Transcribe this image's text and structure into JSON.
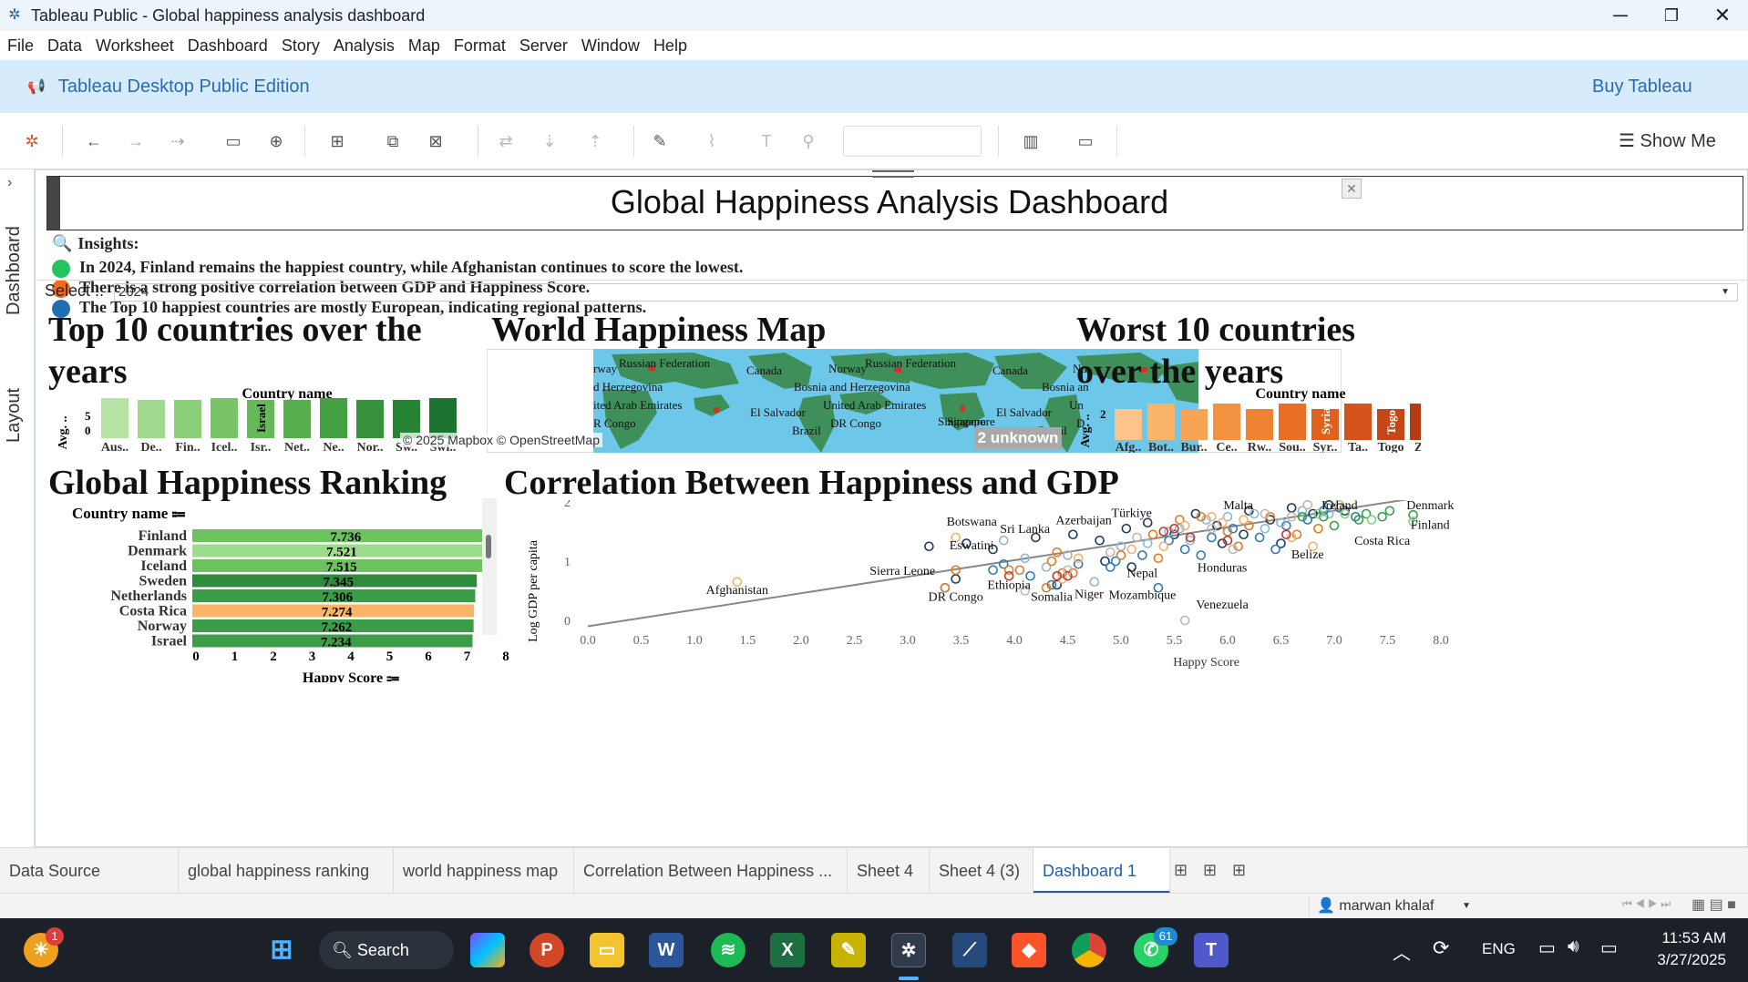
{
  "window": {
    "title": "Tableau Public - Global happiness analysis dashboard"
  },
  "menu": [
    "File",
    "Data",
    "Worksheet",
    "Dashboard",
    "Story",
    "Analysis",
    "Map",
    "Format",
    "Server",
    "Window",
    "Help"
  ],
  "promo": {
    "edition": "Tableau Desktop Public Edition",
    "buy": "Buy Tableau"
  },
  "toolbar": {
    "show_me": "Show Me"
  },
  "rail": {
    "dashboard": "Dashboard",
    "layout": "Layout"
  },
  "dashboard": {
    "title": "Global Happiness Analysis Dashboard",
    "insights_heading": "Insights:",
    "insights": [
      {
        "text": "In 2024, Finland remains the happiest country, while Afghanistan continues to score the lowest.",
        "color": "#21c45d"
      },
      {
        "text": "There is a strong positive correlation between GDP and Happiness Score.",
        "color": "#f26b21"
      },
      {
        "text": "The Top 10 happiest countries are mostly European, indicating regional patterns.",
        "color": "#1f6fb2"
      }
    ],
    "filter": {
      "label": "Select ..",
      "value": "2024"
    },
    "top10": {
      "title": "Top 10 countries over the years",
      "header": "Country name",
      "yaxis": "Avg. ..",
      "yticks": [
        "5",
        "0"
      ],
      "labels": [
        "Aus..",
        "De..",
        "Fin..",
        "Icel..",
        "Isr..",
        "Net..",
        "Ne..",
        "Nor..",
        "Sw..",
        "Swi.."
      ],
      "inner_label": "Israel",
      "colors": [
        "#b5e3a4",
        "#9fd98d",
        "#8ccf79",
        "#79c467",
        "#66b958",
        "#55ad4c",
        "#45a042",
        "#35923a",
        "#268434",
        "#1b7330"
      ]
    },
    "map": {
      "title": "World Happiness Map",
      "attribution": "© 2025 Mapbox © OpenStreetMap",
      "unknown": "2 unknown",
      "labels": [
        "Russian Federation",
        "Norway",
        "Canada",
        "Bosnia and Herzegovina",
        "United Arab Emirates",
        "El Salvador",
        "DR Congo",
        "Singapore",
        "Brazil",
        "Russian Federation",
        "Canada",
        "Bosnia an",
        "Un",
        "El Salvador",
        "Brazil",
        "rway",
        "d Herzegovina",
        "ited Arab Emirates",
        "R Congo",
        "Singapore",
        "No",
        "D"
      ]
    },
    "worst10": {
      "title": "Worst 10 countries over the years",
      "header": "Country name",
      "yaxis": "Avg. ..",
      "ytick": "2",
      "labels": [
        "Afg..",
        "Bot..",
        "Bur..",
        "Ce..",
        "Rw..",
        "Sou..",
        "Syr..",
        "Ta..",
        "Togo",
        "Zi.."
      ],
      "inner_labels": [
        "Syria",
        "Togo"
      ],
      "colors": [
        "#fcc38a",
        "#f9b46a",
        "#f7a555",
        "#f39341",
        "#ef8332",
        "#e96f25",
        "#e0611d",
        "#d4531a",
        "#c54617",
        "#b43c15"
      ]
    },
    "ranking": {
      "title": "Global Happiness Ranking",
      "header": "Country name",
      "xlabel": "Happy Score",
      "xticks": [
        "0",
        "1",
        "2",
        "3",
        "4",
        "5",
        "6",
        "7",
        "8"
      ],
      "rows": [
        {
          "country": "Finland",
          "score": "7.736",
          "value": 7.736,
          "color": "#6cc35e"
        },
        {
          "country": "Denmark",
          "score": "7.521",
          "value": 7.521,
          "color": "#9ddc8c"
        },
        {
          "country": "Iceland",
          "score": "7.515",
          "value": 7.515,
          "color": "#6cc35e"
        },
        {
          "country": "Sweden",
          "score": "7.345",
          "value": 7.345,
          "color": "#2e8b3b"
        },
        {
          "country": "Netherlands",
          "score": "7.306",
          "value": 7.306,
          "color": "#3b9d47"
        },
        {
          "country": "Costa Rica",
          "score": "7.274",
          "value": 7.274,
          "color": "#f9b46a"
        },
        {
          "country": "Norway",
          "score": "7.262",
          "value": 7.262,
          "color": "#3b9d47"
        },
        {
          "country": "Israel",
          "score": "7.234",
          "value": 7.234,
          "color": "#3b9d47"
        }
      ]
    },
    "correlation": {
      "title": "Correlation Between Happiness and GDP",
      "xlabel": "Happy Score",
      "ylabel": "Log GDP per capita",
      "xticks": [
        "0.0",
        "0.5",
        "1.0",
        "1.5",
        "2.0",
        "2.5",
        "3.0",
        "3.5",
        "4.0",
        "4.5",
        "5.0",
        "5.5",
        "6.0",
        "6.5",
        "7.0",
        "7.5",
        "8.0"
      ],
      "yticks": [
        "2",
        "1",
        "0"
      ],
      "labels": [
        {
          "text": "Afghanistan",
          "x": 1.4,
          "y": 0.45
        },
        {
          "text": "Sierra Leone",
          "x": 2.95,
          "y": 0.77
        },
        {
          "text": "Botswana",
          "x": 3.6,
          "y": 1.6
        },
        {
          "text": "Eswatini",
          "x": 3.6,
          "y": 1.2
        },
        {
          "text": "Sri Lanka",
          "x": 4.1,
          "y": 1.48
        },
        {
          "text": "Azerbaijan",
          "x": 4.65,
          "y": 1.62
        },
        {
          "text": "Türkiye",
          "x": 5.1,
          "y": 1.75
        },
        {
          "text": "DR Congo",
          "x": 3.45,
          "y": 0.33
        },
        {
          "text": "Ethiopia",
          "x": 3.95,
          "y": 0.53
        },
        {
          "text": "Somalia",
          "x": 4.35,
          "y": 0.33
        },
        {
          "text": "Niger",
          "x": 4.7,
          "y": 0.38
        },
        {
          "text": "Mozambique",
          "x": 5.2,
          "y": 0.36
        },
        {
          "text": "Nepal",
          "x": 5.2,
          "y": 0.73
        },
        {
          "text": "Honduras",
          "x": 5.95,
          "y": 0.82
        },
        {
          "text": "Venezuela",
          "x": 5.95,
          "y": 0.2
        },
        {
          "text": "Malta",
          "x": 6.1,
          "y": 1.95
        },
        {
          "text": "Ireland",
          "x": 7.05,
          "y": 2.25
        },
        {
          "text": "Denmark",
          "x": 7.9,
          "y": 2.02
        },
        {
          "text": "Finland",
          "x": 7.9,
          "y": 1.55
        },
        {
          "text": "Costa Rica",
          "x": 7.45,
          "y": 1.28
        },
        {
          "text": "Belize",
          "x": 6.75,
          "y": 1.05
        }
      ]
    }
  },
  "chart_data": [
    {
      "type": "bar",
      "title": "Global Happiness Ranking",
      "categories": [
        "Finland",
        "Denmark",
        "Iceland",
        "Sweden",
        "Netherlands",
        "Costa Rica",
        "Norway",
        "Israel"
      ],
      "values": [
        7.736,
        7.521,
        7.515,
        7.345,
        7.306,
        7.274,
        7.262,
        7.234
      ],
      "xlabel": "Happy Score",
      "xlim": [
        0,
        8
      ]
    },
    {
      "type": "scatter",
      "title": "Correlation Between Happiness and GDP",
      "xlabel": "Happy Score",
      "ylabel": "Log GDP per capita",
      "xlim": [
        0,
        8
      ],
      "ylim": [
        0,
        2
      ],
      "trend": {
        "x": [
          0,
          8
        ],
        "y": [
          -0.1,
          2.07
        ]
      },
      "series": [
        {
          "color": "#1f3b5a",
          "points": [
            [
              3.2,
              1.25
            ],
            [
              3.55,
              1.3
            ],
            [
              3.8,
              1.2
            ],
            [
              4.2,
              1.4
            ],
            [
              4.55,
              1.45
            ],
            [
              4.8,
              1.35
            ],
            [
              5.05,
              1.55
            ],
            [
              5.25,
              1.65
            ],
            [
              5.5,
              1.45
            ],
            [
              5.7,
              1.8
            ],
            [
              5.9,
              1.6
            ],
            [
              6.2,
              1.85
            ],
            [
              6.4,
              1.7
            ],
            [
              6.6,
              1.9
            ],
            [
              6.8,
              1.8
            ],
            [
              6.95,
              1.95
            ],
            [
              7.1,
              1.85
            ],
            [
              3.45,
              0.7
            ],
            [
              4.4,
              0.6
            ],
            [
              4.85,
              1.0
            ],
            [
              5.1,
              0.9
            ],
            [
              6.5,
              1.3
            ],
            [
              6.15,
              1.45
            ],
            [
              5.95,
              1.3
            ]
          ]
        },
        {
          "color": "#2a7ab8",
          "points": [
            [
              3.35,
              0.55
            ],
            [
              3.8,
              0.85
            ],
            [
              4.15,
              0.75
            ],
            [
              4.35,
              0.6
            ],
            [
              4.6,
              0.95
            ],
            [
              4.95,
              1.0
            ],
            [
              5.2,
              1.1
            ],
            [
              5.35,
              0.55
            ],
            [
              5.6,
              1.2
            ],
            [
              5.85,
              1.4
            ],
            [
              6.05,
              1.55
            ],
            [
              6.3,
              1.4
            ],
            [
              6.55,
              1.6
            ],
            [
              6.75,
              1.7
            ],
            [
              6.9,
              1.85
            ],
            [
              7.05,
              1.9
            ],
            [
              7.2,
              1.75
            ],
            [
              5.45,
              1.35
            ],
            [
              6.45,
              1.2
            ],
            [
              4.9,
              0.9
            ],
            [
              3.9,
              0.95
            ],
            [
              5.75,
              1.1
            ]
          ]
        },
        {
          "color": "#8fb6d4",
          "points": [
            [
              3.9,
              1.35
            ],
            [
              4.3,
              0.9
            ],
            [
              4.5,
              1.1
            ],
            [
              4.75,
              0.65
            ],
            [
              5.0,
              1.25
            ],
            [
              5.25,
              1.3
            ],
            [
              5.55,
              1.55
            ],
            [
              5.8,
              1.7
            ],
            [
              6.0,
              1.75
            ],
            [
              6.25,
              1.8
            ],
            [
              6.5,
              1.65
            ],
            [
              6.7,
              1.85
            ],
            [
              6.95,
              1.8
            ],
            [
              5.65,
              1.35
            ],
            [
              6.35,
              1.55
            ],
            [
              4.1,
              1.05
            ],
            [
              5.45,
              1.5
            ]
          ]
        },
        {
          "color": "#e07b22",
          "points": [
            [
              3.45,
              0.85
            ],
            [
              3.95,
              0.85
            ],
            [
              4.05,
              0.85
            ],
            [
              4.3,
              0.55
            ],
            [
              4.45,
              0.8
            ],
            [
              4.55,
              0.8
            ],
            [
              4.4,
              1.15
            ],
            [
              5.0,
              1.1
            ],
            [
              5.3,
              1.45
            ],
            [
              5.55,
              1.7
            ],
            [
              5.75,
              1.75
            ],
            [
              6.0,
              1.5
            ],
            [
              6.2,
              1.6
            ],
            [
              6.4,
              1.75
            ],
            [
              6.65,
              1.45
            ],
            [
              6.85,
              1.55
            ],
            [
              5.35,
              1.05
            ],
            [
              6.1,
              1.25
            ],
            [
              4.35,
              1.0
            ],
            [
              3.35,
              0.55
            ]
          ]
        },
        {
          "color": "#f5b06a",
          "points": [
            [
              1.4,
              0.65
            ],
            [
              3.45,
              1.4
            ],
            [
              4.45,
              0.7
            ],
            [
              5.1,
              1.2
            ],
            [
              5.4,
              1.25
            ],
            [
              5.6,
              1.6
            ],
            [
              5.85,
              1.75
            ],
            [
              6.15,
              1.7
            ],
            [
              6.6,
              1.4
            ],
            [
              7.05,
              1.95
            ],
            [
              7.25,
              2.0
            ],
            [
              6.8,
              1.25
            ],
            [
              5.95,
              1.65
            ],
            [
              4.6,
              1.05
            ]
          ]
        },
        {
          "color": "#c0392b",
          "points": [
            [
              3.95,
              0.75
            ],
            [
              4.4,
              0.75
            ],
            [
              4.5,
              0.75
            ],
            [
              5.5,
              1.55
            ],
            [
              5.65,
              1.4
            ],
            [
              6.0,
              1.35
            ],
            [
              6.55,
              1.45
            ],
            [
              5.4,
              1.5
            ]
          ]
        },
        {
          "color": "#3a9d48",
          "points": [
            [
              7.3,
              1.8
            ],
            [
              7.45,
              1.75
            ],
            [
              7.52,
              1.85
            ],
            [
              7.74,
              1.78
            ],
            [
              6.9,
              1.75
            ],
            [
              6.7,
              1.75
            ],
            [
              7.0,
              1.6
            ],
            [
              7.23,
              1.7
            ]
          ]
        },
        {
          "color": "#7fd07f",
          "points": [
            [
              7.74,
              1.67
            ],
            [
              7.1,
              1.8
            ],
            [
              7.35,
              1.7
            ],
            [
              6.85,
              1.8
            ]
          ]
        },
        {
          "color": "#b9b9b9",
          "points": [
            [
              5.6,
              0.0
            ],
            [
              4.5,
              0.85
            ],
            [
              6.05,
              1.2
            ],
            [
              5.85,
              1.55
            ],
            [
              6.35,
              1.8
            ],
            [
              6.75,
              1.95
            ],
            [
              4.1,
              0.5
            ],
            [
              4.9,
              1.15
            ],
            [
              5.15,
              1.4
            ],
            [
              6.6,
              1.75
            ]
          ]
        }
      ]
    }
  ],
  "sheet_tabs": [
    "Data Source",
    "global happiness ranking",
    "world happiness map",
    "Correlation Between Happiness ...",
    "Sheet 4",
    "Sheet 4 (3)",
    "Dashboard 1"
  ],
  "status": {
    "user": "marwan khalaf"
  },
  "taskbar": {
    "search": "Search",
    "lang": "ENG",
    "time": "11:53 AM",
    "date": "3/27/2025",
    "weather_badge": "1",
    "whatsapp_badge": "61"
  }
}
